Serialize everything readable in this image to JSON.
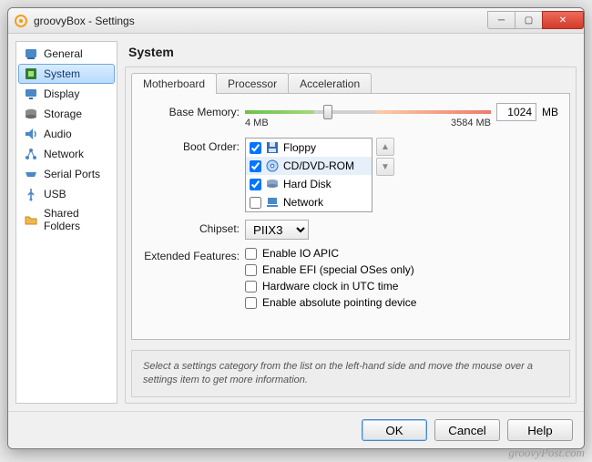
{
  "window": {
    "title": "groovyBox - Settings"
  },
  "sidebar": {
    "items": [
      {
        "label": "General"
      },
      {
        "label": "System"
      },
      {
        "label": "Display"
      },
      {
        "label": "Storage"
      },
      {
        "label": "Audio"
      },
      {
        "label": "Network"
      },
      {
        "label": "Serial Ports"
      },
      {
        "label": "USB"
      },
      {
        "label": "Shared Folders"
      }
    ],
    "active_index": 1
  },
  "page": {
    "title": "System"
  },
  "tabs": [
    {
      "label": "Motherboard"
    },
    {
      "label": "Processor"
    },
    {
      "label": "Acceleration"
    }
  ],
  "active_tab": 0,
  "memory": {
    "label": "Base Memory:",
    "value": "1024",
    "unit": "MB",
    "min_label": "4 MB",
    "max_label": "3584 MB"
  },
  "boot": {
    "label": "Boot Order:",
    "items": [
      {
        "checked": true,
        "label": "Floppy"
      },
      {
        "checked": true,
        "label": "CD/DVD-ROM"
      },
      {
        "checked": true,
        "label": "Hard Disk"
      },
      {
        "checked": false,
        "label": "Network"
      }
    ]
  },
  "chipset": {
    "label": "Chipset:",
    "value": "PIIX3"
  },
  "ext": {
    "label": "Extended Features:",
    "items": [
      {
        "checked": false,
        "label": "Enable IO APIC"
      },
      {
        "checked": false,
        "label": "Enable EFI (special OSes only)"
      },
      {
        "checked": false,
        "label": "Hardware clock in UTC time"
      },
      {
        "checked": false,
        "label": "Enable absolute pointing device"
      }
    ]
  },
  "hint": "Select a settings category from the list on the left-hand side and move the mouse over a settings item to get more information.",
  "buttons": {
    "ok": "OK",
    "cancel": "Cancel",
    "help": "Help"
  },
  "watermark": "groovyPost.com"
}
